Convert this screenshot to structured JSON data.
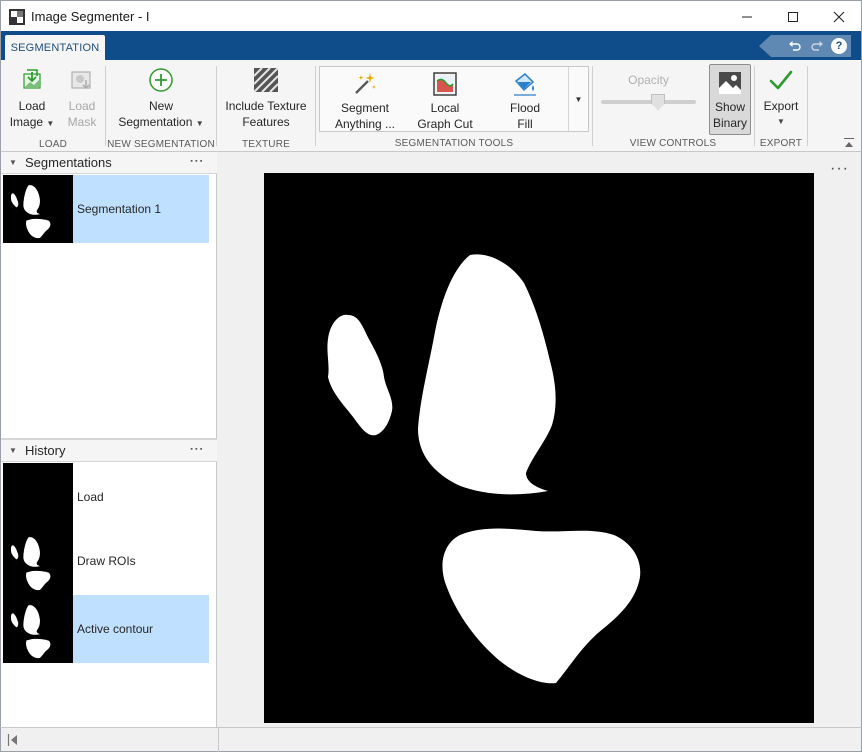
{
  "window": {
    "title": "Image Segmenter - I",
    "minimize_icon": "minimize-icon",
    "maximize_icon": "maximize-icon",
    "close_icon": "close-icon"
  },
  "tabs": [
    {
      "label": "SEGMENTATION",
      "active": true
    }
  ],
  "quick_access": {
    "undo_icon": "undo-icon",
    "redo_icon": "redo-icon",
    "help_label": "?"
  },
  "toolstrip": {
    "load": {
      "section_label": "LOAD",
      "load_image_label_1": "Load",
      "load_image_label_2": "Image",
      "load_mask_label_1": "Load",
      "load_mask_label_2": "Mask"
    },
    "new_segmentation": {
      "section_label": "NEW SEGMENTATION",
      "label_1": "New",
      "label_2": "Segmentation"
    },
    "texture": {
      "section_label": "TEXTURE",
      "label_1": "Include Texture",
      "label_2": "Features"
    },
    "segmentation_tools": {
      "section_label": "SEGMENTATION TOOLS",
      "items": [
        {
          "label_1": "Segment",
          "label_2": "Anything ...",
          "icon": "magic-wand-icon"
        },
        {
          "label_1": "Local",
          "label_2": "Graph Cut",
          "icon": "graph-cut-icon"
        },
        {
          "label_1": "Flood",
          "label_2": "Fill",
          "icon": "paint-bucket-icon"
        }
      ]
    },
    "view_controls": {
      "section_label": "VIEW CONTROLS",
      "opacity_label": "Opacity",
      "opacity_value": 0.6,
      "show_binary_label_1": "Show",
      "show_binary_label_2": "Binary",
      "show_binary_on": true
    },
    "export": {
      "section_label": "EXPORT",
      "label": "Export"
    }
  },
  "segmentations_panel": {
    "title": "Segmentations",
    "items": [
      {
        "label": "Segmentation 1",
        "selected": true
      }
    ]
  },
  "history_panel": {
    "title": "History",
    "items": [
      {
        "label": "Load",
        "selected": false
      },
      {
        "label": "Draw ROIs",
        "selected": false
      },
      {
        "label": "Active contour",
        "selected": true
      }
    ]
  },
  "colors": {
    "tabstrip": "#0e4d8a",
    "selection": "#bfe1ff",
    "mask_background": "#000000",
    "mask_foreground": "#ffffff",
    "accept_green": "#2e9b2e"
  }
}
